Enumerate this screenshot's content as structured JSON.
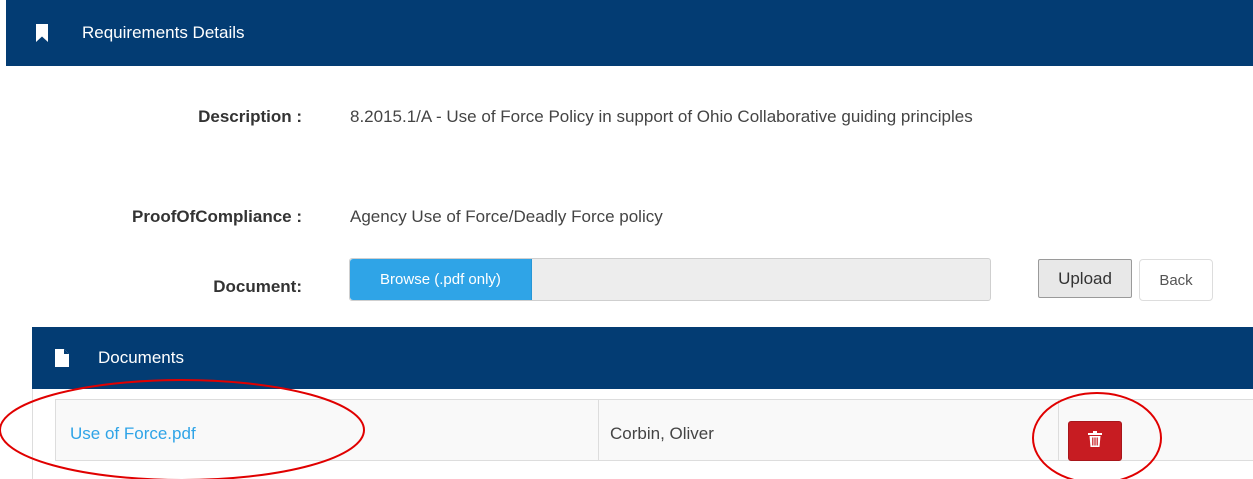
{
  "requirements_panel": {
    "title": "Requirements Details",
    "icon": "bookmark-icon"
  },
  "form": {
    "description_label": "Description :",
    "description_value": "8.2015.1/A - Use of Force Policy in support of Ohio Collaborative guiding principles",
    "proof_label": "ProofOfCompliance :",
    "proof_value": "Agency Use of Force/Deadly Force policy",
    "document_label": "Document:",
    "browse_label": "Browse (.pdf only)",
    "upload_label": "Upload",
    "back_label": "Back"
  },
  "documents_panel": {
    "title": "Documents",
    "icon": "file-icon",
    "rows": [
      {
        "file_name": "Use of Force.pdf",
        "uploaded_by": "Corbin, Oliver",
        "action_icon": "trash-icon"
      }
    ]
  },
  "colors": {
    "header_bg": "#033c73",
    "primary": "#2fa4e7",
    "danger": "#c71c22",
    "annotation": "#e00000"
  }
}
